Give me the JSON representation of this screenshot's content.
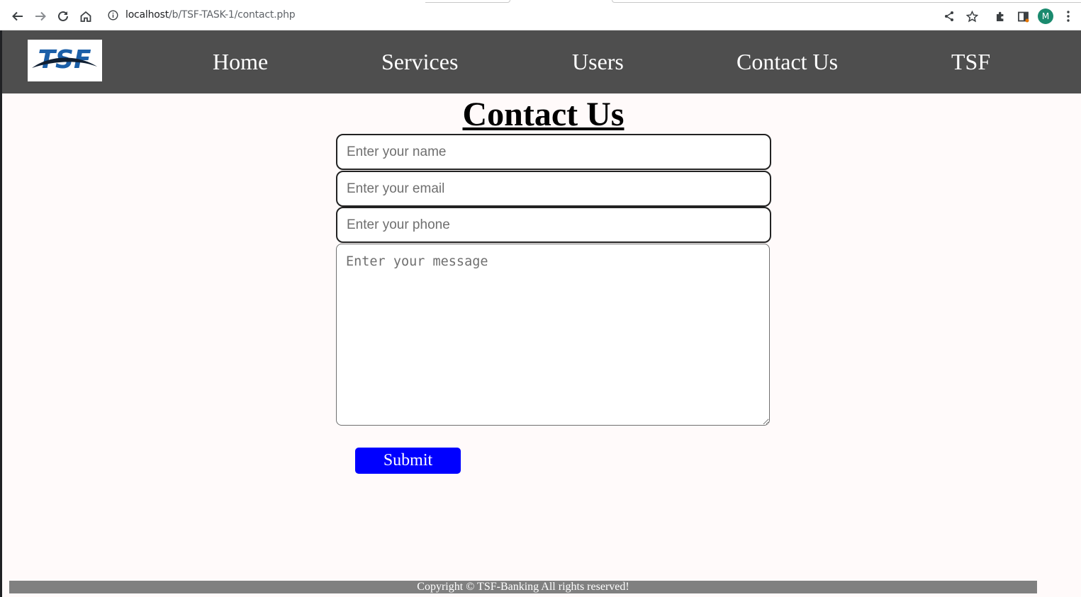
{
  "browser": {
    "url_host": "localhost",
    "url_path": "/b/TSF-TASK-1/contact.php",
    "profile_initial": "M",
    "icons": [
      "back-icon",
      "forward-icon",
      "reload-icon",
      "home-icon",
      "info-icon",
      "share-icon",
      "star-icon",
      "extensions-icon",
      "side-panel-icon",
      "menu-icon"
    ]
  },
  "nav": {
    "logo_text": "TSF",
    "items": [
      {
        "label": "Home"
      },
      {
        "label": "Services"
      },
      {
        "label": "Users"
      },
      {
        "label": "Contact Us"
      },
      {
        "label": "TSF"
      }
    ]
  },
  "main": {
    "title": "Contact Us",
    "name_placeholder": "Enter your name",
    "email_placeholder": "Enter your email",
    "phone_placeholder": "Enter your phone",
    "message_placeholder": "Enter your message",
    "submit_label": "Submit"
  },
  "footer": {
    "text": "Copyright © TSF-Banking All rights reserved!"
  },
  "colors": {
    "nav_bg": "#4e4e4e",
    "submit_bg": "#0000ff",
    "footer_bg": "#808080",
    "page_bg": "#fffafa",
    "logo_blue": "#1b5fa8"
  }
}
